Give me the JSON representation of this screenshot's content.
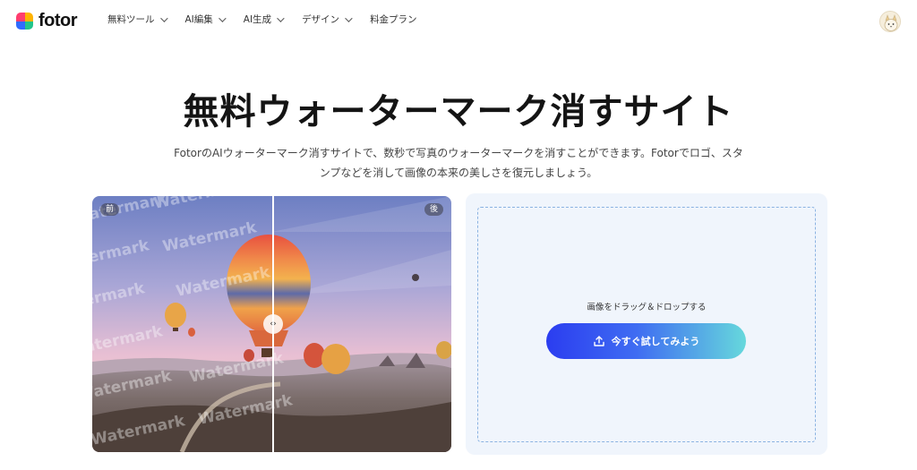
{
  "header": {
    "logo_text": "fotor",
    "nav": [
      {
        "label": "無料ツール",
        "has_dropdown": true
      },
      {
        "label": "AI編集",
        "has_dropdown": true
      },
      {
        "label": "AI生成",
        "has_dropdown": true
      },
      {
        "label": "デザイン",
        "has_dropdown": true
      },
      {
        "label": "料金プラン",
        "has_dropdown": false
      }
    ]
  },
  "hero": {
    "title": "無料ウォーターマーク消すサイト",
    "subtitle": "FotorのAIウォーターマーク消すサイトで、数秒で写真のウォーターマークを消すことができます。Fotorでロゴ、スタンプなどを消して画像の本来の美しさを復元しましょう。"
  },
  "compare": {
    "before_label": "前",
    "after_label": "後",
    "watermark_text": "Watermark"
  },
  "upload": {
    "drop_text": "画像をドラッグ＆ドロップする",
    "button_label": "今すぐ試してみよう"
  },
  "colors": {
    "accent_start": "#2b3df0",
    "accent_end": "#66d8dc",
    "upload_bg": "#f0f5fc"
  }
}
